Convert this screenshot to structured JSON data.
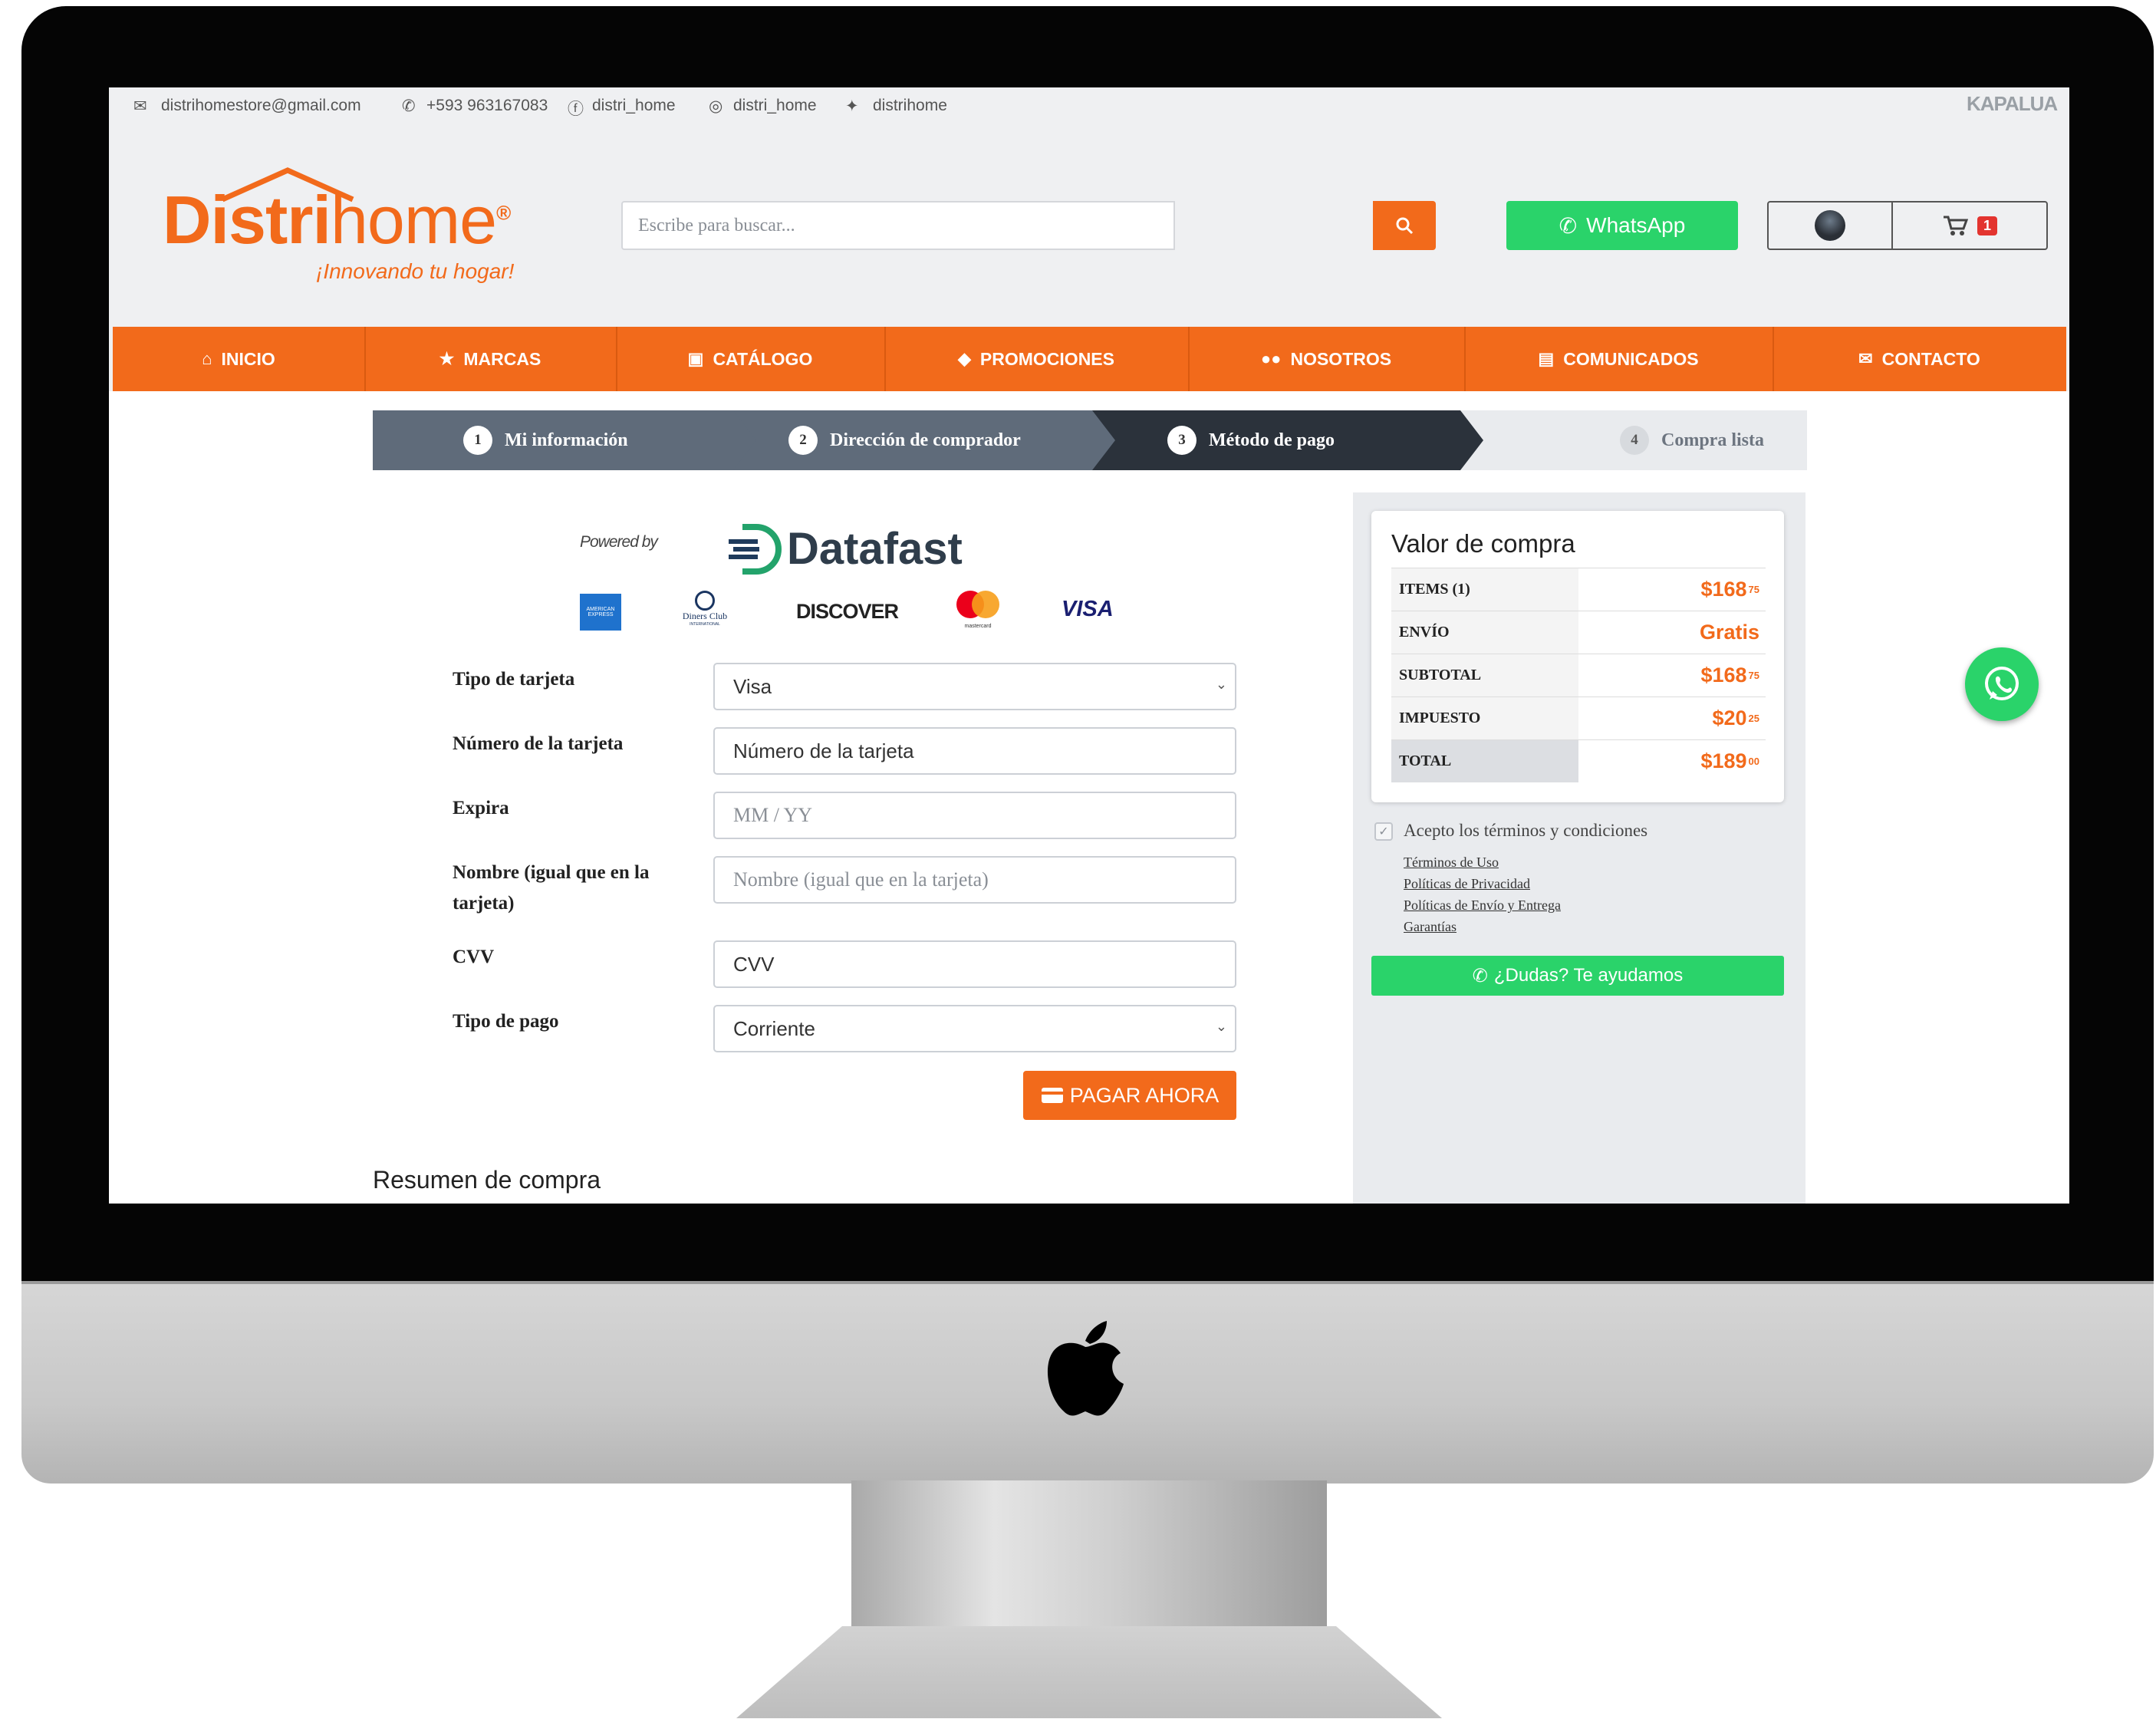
{
  "topbar": {
    "email": "distrihomestore@gmail.com",
    "phone": "+593 963167083",
    "facebook": "distri_home",
    "instagram": "distri_home",
    "twitter": "distrihome",
    "corner_logo": "KAPALUA"
  },
  "logo": {
    "part1": "Distri",
    "part2": "home",
    "reg": "®",
    "tagline": "¡Innovando tu hogar!"
  },
  "search": {
    "placeholder": "Escribe para buscar..."
  },
  "whatsapp_button": "WhatsApp",
  "cart": {
    "count": "1"
  },
  "nav": [
    {
      "label": "INICIO",
      "icon": "home-icon"
    },
    {
      "label": "MARCAS",
      "icon": "star-icon"
    },
    {
      "label": "CATÁLOGO",
      "icon": "images-icon"
    },
    {
      "label": "PROMOCIONES",
      "icon": "tag-icon"
    },
    {
      "label": "NOSOTROS",
      "icon": "users-icon"
    },
    {
      "label": "COMUNICADOS",
      "icon": "newspaper-icon"
    },
    {
      "label": "CONTACTO",
      "icon": "envelope-icon"
    }
  ],
  "steps": [
    {
      "num": "1",
      "label": "Mi información"
    },
    {
      "num": "2",
      "label": "Dirección de comprador"
    },
    {
      "num": "3",
      "label": "Método de pago"
    },
    {
      "num": "4",
      "label": "Compra lista"
    }
  ],
  "payment": {
    "powered_by": "Powered by",
    "brand": "Datafast",
    "card_logos": [
      "AMERICAN EXPRESS",
      "Diners Club",
      "DISCOVER",
      "mastercard",
      "VISA"
    ],
    "diners_small": "INTERNATIONAL",
    "fields": {
      "tipo_tarjeta": {
        "label": "Tipo de tarjeta",
        "value": "Visa"
      },
      "numero": {
        "label": "Número de la tarjeta",
        "placeholder": "Número de la tarjeta"
      },
      "expira": {
        "label": "Expira",
        "placeholder": "MM / YY"
      },
      "nombre": {
        "label_line1": "Nombre (igual que en la",
        "label_line2": "tarjeta)",
        "placeholder": "Nombre (igual que en la tarjeta)"
      },
      "cvv": {
        "label": "CVV",
        "placeholder": "CVV"
      },
      "tipo_pago": {
        "label": "Tipo de pago",
        "value": "Corriente"
      }
    },
    "pay_button": "PAGAR AHORA"
  },
  "resumen_title": "Resumen de compra",
  "summary": {
    "title": "Valor de compra",
    "rows": [
      {
        "key": "ITEMS (1)",
        "currency": "$",
        "value": "168",
        "cents": "75"
      },
      {
        "key": "ENVÍO",
        "currency": "",
        "value": "Gratis",
        "cents": ""
      },
      {
        "key": "SUBTOTAL",
        "currency": "$",
        "value": "168",
        "cents": "75"
      },
      {
        "key": "IMPUESTO",
        "currency": "$",
        "value": "20",
        "cents": "25"
      },
      {
        "key": "TOTAL",
        "currency": "$",
        "value": "189",
        "cents": "00"
      }
    ],
    "terms_label": "Acepto los términos y condiciones",
    "links": [
      "Términos de Uso",
      "Políticas de Privacidad",
      "Políticas de Envío y Entrega",
      "Garantías"
    ],
    "help_button": "¿Dudas? Te ayudamos"
  },
  "colors": {
    "brand_orange": "#f26a1b",
    "whatsapp_green": "#2ad36a",
    "step_dark": "#2b323b",
    "step_mid": "#5f6b7a"
  }
}
